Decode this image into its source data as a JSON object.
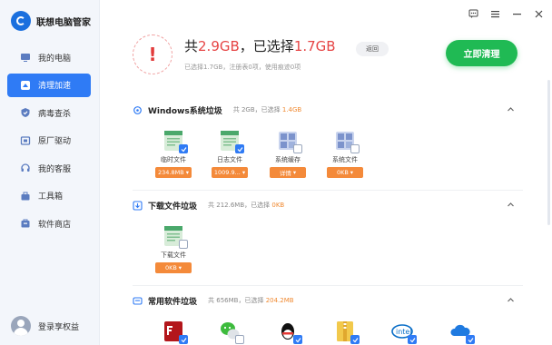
{
  "app": {
    "name": "联想电脑管家"
  },
  "sidebar": {
    "items": [
      {
        "label": "我的电脑",
        "icon": "computer-icon",
        "active": false
      },
      {
        "label": "清理加速",
        "icon": "broom-icon",
        "active": true
      },
      {
        "label": "病毒查杀",
        "icon": "shield-icon",
        "active": false
      },
      {
        "label": "原厂驱动",
        "icon": "driver-icon",
        "active": false
      },
      {
        "label": "我的客服",
        "icon": "headset-icon",
        "active": false
      },
      {
        "label": "工具箱",
        "icon": "toolbox-icon",
        "active": false
      },
      {
        "label": "软件商店",
        "icon": "store-icon",
        "active": false
      }
    ],
    "login_label": "登录享权益"
  },
  "summary": {
    "prefix": "共",
    "total": "2.9GB",
    "mid": "，已选择",
    "selected": "1.7GB",
    "back_label": "返回",
    "sub": "已选择1.7GB，注册表0项，使用痕迹0项",
    "clean_label": "立即清理"
  },
  "sections": [
    {
      "title": "Windows系统垃圾",
      "info_prefix": "共 2GB，已选择",
      "info_selected": "1.4GB",
      "items": [
        {
          "name": "临时文件",
          "tag": "234.8MB",
          "checked": true
        },
        {
          "name": "日志文件",
          "tag": "1009.9...",
          "checked": true
        },
        {
          "name": "系统缓存",
          "tag": "详情",
          "checked": false
        },
        {
          "name": "系统文件",
          "tag": "0KB",
          "checked": false
        }
      ]
    },
    {
      "title": "下载文件垃圾",
      "info_prefix": "共 212.6MB，已选择",
      "info_selected": "0KB",
      "items": [
        {
          "name": "下载文件",
          "tag": "0KB",
          "checked": false
        }
      ]
    },
    {
      "title": "常用软件垃圾",
      "info_prefix": "共 656MB，已选择",
      "info_selected": "204.2MB",
      "items": []
    }
  ],
  "colors": {
    "accent": "#2f7bf5",
    "green": "#20ba54",
    "red": "#e64545",
    "orange": "#f48a3a"
  }
}
